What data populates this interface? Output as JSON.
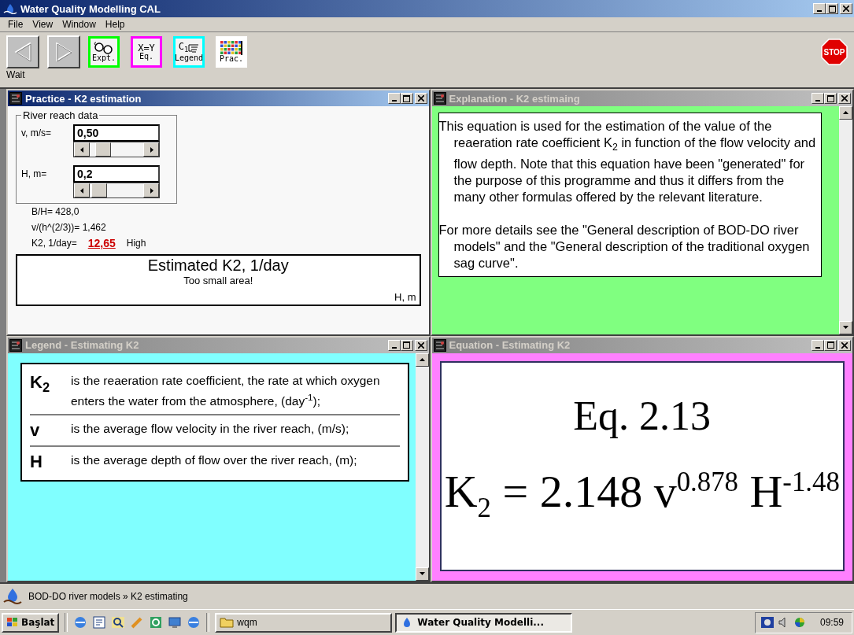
{
  "window": {
    "title": "Water Quality Modelling CAL"
  },
  "menu": [
    "File",
    "View",
    "Window",
    "Help"
  ],
  "toolbar": {
    "nav": [
      {
        "kind": "back",
        "disabled": true
      },
      {
        "kind": "forward",
        "disabled": true
      }
    ],
    "status": "Wait",
    "tools": [
      {
        "kind": "experiment",
        "label": "Expt.",
        "color": "#00ff00"
      },
      {
        "kind": "equation",
        "glyph": "X=Y",
        "label": "Eq.",
        "color": "#ff00ff"
      },
      {
        "kind": "legend",
        "glyph": "C$_{1}$",
        "label": "Legend",
        "color": "#00ffff"
      },
      {
        "kind": "practice",
        "label": "Prac."
      }
    ],
    "stop": "STOP"
  },
  "windows": [
    {
      "kind": "practice",
      "title": "Practice - K2 estimation",
      "active": true,
      "color": "#f8f8f8",
      "group": {
        "title": "River reach data",
        "inputs": [
          {
            "label": "v, m/s=",
            "value": "0,50",
            "level": 0.14
          },
          {
            "label": "H, m=",
            "value": "0,2",
            "level": 0.04
          }
        ]
      },
      "results": [
        {
          "text": "B/H= 428,0"
        },
        {
          "text": "v/(h^(2/3))= 1,462"
        },
        {
          "text": "K2, 1/day=",
          "value": "12,65",
          "rating": "High"
        }
      ],
      "plot": {
        "title": "Estimated K2, 1/day",
        "message": "Too small area!",
        "xlabel": "H, m"
      }
    },
    {
      "kind": "explanation",
      "title": "Explanation - K2 estimaing",
      "active": false,
      "color": "#80ff80",
      "paragraphs": [
        "This equation is used for the estimation of the value of the reaeration rate coefficient K$_{2}$ in function of the flow velocity and flow depth. Note that this equation have been \"generated\" for the purpose of this programme and thus it differs from the many other formulas offered by the relevant literature.",
        "For more details see the \"General description of BOD-DO river models\" and the \"General description of the traditional oxygen sag curve\"."
      ]
    },
    {
      "kind": "legend",
      "title": "Legend - Estimating K2",
      "active": false,
      "color": "#80ffff",
      "rows": [
        {
          "symbol": "K$_{2}$",
          "text": "is the reaeration rate coefficient, the rate at which oxygen enters the water from the atmosphere, (day$^{-1}$);"
        },
        {
          "symbol": "v",
          "text": "is the average flow velocity in the river reach, (m/s);"
        },
        {
          "symbol": "H",
          "text": "is the average depth of flow over the river reach, (m);"
        }
      ]
    },
    {
      "kind": "equation",
      "title": "Equation - Estimating K2",
      "active": false,
      "color": "#ff80ff",
      "caption": "Eq. 2.13",
      "formula": "K$_{2}$ = 2.148 v$^{0.878}$ H$^{-1.48}$"
    }
  ],
  "status_bar": {
    "text": "BOD-DO river models » K2 estimating"
  },
  "taskbar": {
    "start": "Başlat",
    "tasks": [
      {
        "kind": "folder",
        "label": "wqm",
        "selected": false
      },
      {
        "kind": "app",
        "label": "Water Quality Modelli...",
        "selected": true
      }
    ],
    "clock": "09:59"
  }
}
